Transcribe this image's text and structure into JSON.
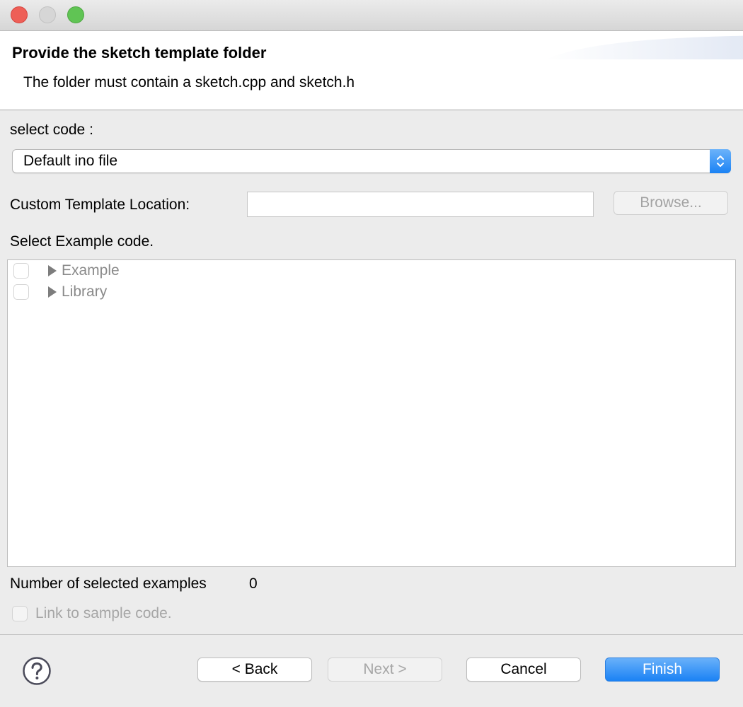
{
  "header": {
    "title": "Provide the sketch template folder",
    "description": "The folder must contain a sketch.cpp and sketch.h"
  },
  "select_code": {
    "label": "select code :",
    "value": "Default ino file"
  },
  "custom_template": {
    "label": "Custom Template Location:",
    "value": "",
    "browse_label": "Browse..."
  },
  "examples": {
    "label": "Select Example code.",
    "items": [
      {
        "label": "Example",
        "checked": false
      },
      {
        "label": "Library",
        "checked": false
      }
    ],
    "count_label": "Number of selected examples",
    "count_value": "0"
  },
  "link_sample": {
    "label": "Link to sample code.",
    "checked": false
  },
  "footer": {
    "back_label": "< Back",
    "next_label": "Next >",
    "cancel_label": "Cancel",
    "finish_label": "Finish"
  },
  "colors": {
    "accent": "#1b82f4",
    "close": "#ee5f57",
    "maximize": "#60c454"
  }
}
